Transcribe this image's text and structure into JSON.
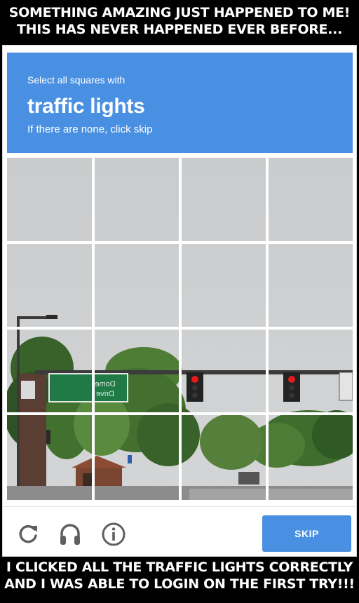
{
  "meme": {
    "top_line1": "SOMETHING AMAZING JUST HAPPENED TO ME!",
    "top_line2": "THIS HAS NEVER HAPPENED EVER BEFORE...",
    "bottom_line1": "I CLICKED ALL THE TRAFFIC LIGHTS CORRECTLY",
    "bottom_line2": "AND I WAS ABLE TO LOGIN ON THE FIRST TRY!!!"
  },
  "captcha": {
    "prompt": "Select all squares with",
    "target": "traffic lights",
    "hint": "If there are none, click skip",
    "grid": {
      "rows": 4,
      "cols": 4
    },
    "sign_text_line1": "Dome",
    "sign_text_line2": "Drive",
    "footer": {
      "reload_icon": "reload-icon",
      "audio_icon": "headphones-icon",
      "info_icon": "info-icon",
      "skip_label": "SKIP"
    }
  },
  "colors": {
    "header_blue": "#4a90e2",
    "skip_blue": "#4a90e2",
    "signal_red": "#e31b1b",
    "sign_green": "#1f7a46"
  }
}
